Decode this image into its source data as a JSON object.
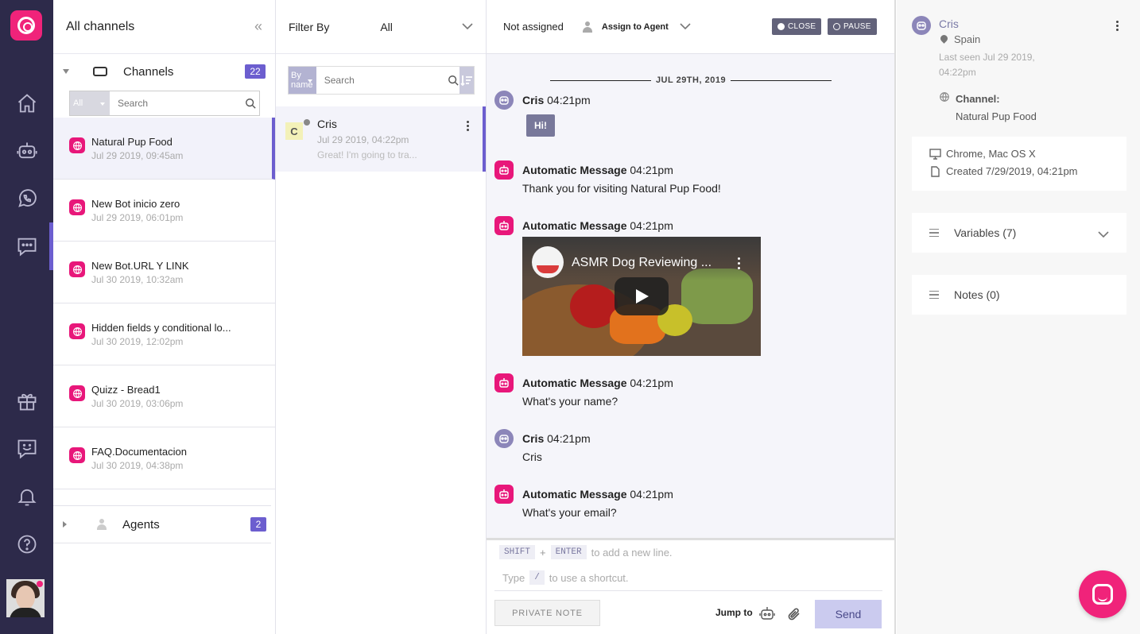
{
  "nav": {
    "items": [
      "home-icon",
      "bot-icon",
      "whatsapp-icon",
      "chat-icon",
      "gift-icon",
      "feedback-icon",
      "bell-icon",
      "help-icon"
    ]
  },
  "channels": {
    "title": "All channels",
    "group_label": "Channels",
    "group_count": "22",
    "filter_value": "All",
    "search_placeholder": "Search",
    "items": [
      {
        "name": "Natural Pup Food",
        "date": "Jul 29 2019, 09:45am"
      },
      {
        "name": "New Bot inicio zero",
        "date": "Jul 29 2019, 06:01pm"
      },
      {
        "name": "New Bot.URL Y LINK",
        "date": "Jul 30 2019, 10:32am"
      },
      {
        "name": "Hidden fields y conditional lo...",
        "date": "Jul 30 2019, 12:02pm"
      },
      {
        "name": "Quizz - Bread1",
        "date": "Jul 30 2019, 03:06pm"
      },
      {
        "name": "FAQ.Documentacion",
        "date": "Jul 30 2019, 04:38pm"
      }
    ],
    "agents_label": "Agents",
    "agents_count": "2"
  },
  "conversations": {
    "filter_label": "Filter By",
    "filter_value": "All",
    "search_mode": "By name",
    "search_placeholder": "Search",
    "items": [
      {
        "initial": "C",
        "name": "Cris",
        "date": "Jul 29 2019, 04:22pm",
        "preview": "Great! I'm going to tra..."
      }
    ]
  },
  "chat": {
    "assigned": "Not assigned",
    "assign_label": "Assign to Agent",
    "close_label": "CLOSE",
    "pause_label": "PAUSE",
    "date_separator": "JUL 29TH, 2019",
    "messages": [
      {
        "author": "Cris",
        "time": "04:21pm",
        "text": "Hi!"
      },
      {
        "author": "Automatic Message",
        "time": "04:21pm",
        "text": "Thank you for visiting Natural Pup Food!"
      },
      {
        "author": "Automatic Message",
        "time": "04:21pm",
        "video_title": "ASMR Dog Reviewing ..."
      },
      {
        "author": "Automatic Message",
        "time": "04:21pm",
        "text": "What's your name?"
      },
      {
        "author": "Cris",
        "time": "04:21pm",
        "text": "Cris"
      },
      {
        "author": "Automatic Message",
        "time": "04:21pm",
        "text": "What's your email?"
      }
    ],
    "composer": {
      "shift": "SHIFT",
      "plus": "+",
      "enter": "ENTER",
      "hint1": "to add a new line.",
      "type": "Type",
      "slash": "/",
      "hint2": "to use a shortcut.",
      "private_note": "PRIVATE NOTE",
      "jump_to": "Jump to",
      "send": "Send"
    }
  },
  "profile": {
    "name": "Cris",
    "location": "Spain",
    "last_seen": "Last seen Jul 29 2019, 04:22pm",
    "channel_label": "Channel:",
    "channel_value": "Natural Pup Food",
    "device": "Chrome, Mac OS X",
    "created": "Created 7/29/2019, 04:21pm",
    "variables": "Variables (7)",
    "notes": "Notes (0)"
  },
  "colors": {
    "brand": "#f0237a",
    "accent": "#6c5ecf",
    "nav_bg": "#2d2a4a"
  }
}
